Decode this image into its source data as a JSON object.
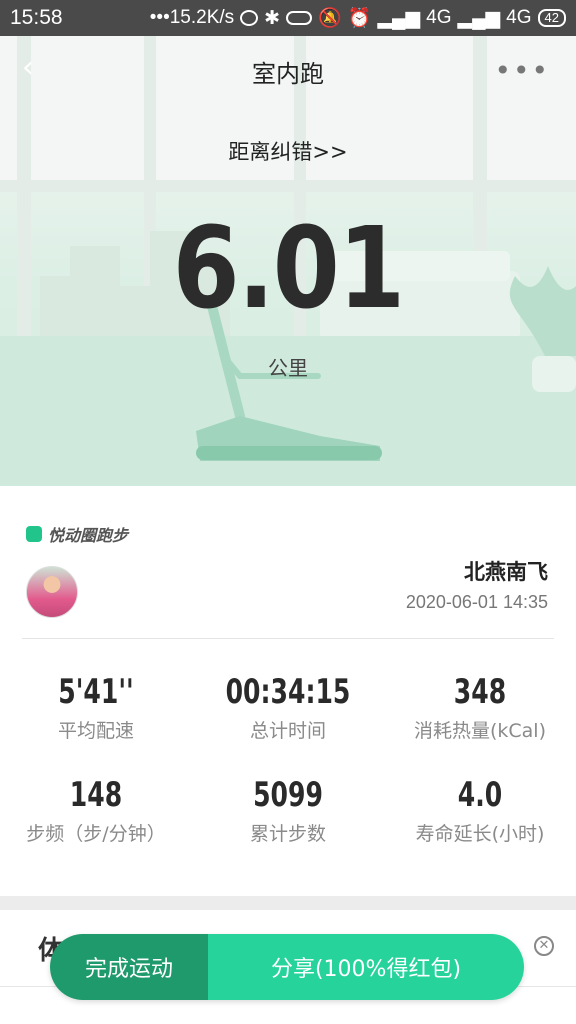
{
  "status_bar": {
    "time": "15:58",
    "network_speed": "15.2K/s",
    "signal_1": "4G",
    "signal_2": "4G",
    "battery": "42"
  },
  "header": {
    "title": "室内跑",
    "back_icon": "chevron-left-icon",
    "more_icon": "more-dots-icon"
  },
  "hero": {
    "distance_correction_link": "距离纠错>>",
    "distance_value": "6.01",
    "distance_unit": "公里"
  },
  "card": {
    "brand": "悦动圈跑步",
    "user_name": "北燕南飞",
    "datetime": "2020-06-01 14:35",
    "stats": [
      {
        "value": "5'41''",
        "label": "平均配速"
      },
      {
        "value": "00:34:15",
        "label": "总计时间"
      },
      {
        "value": "348",
        "label": "消耗热量(kCal)"
      },
      {
        "value": "148",
        "label": "步频（步/分钟）"
      },
      {
        "value": "5099",
        "label": "累计步数"
      },
      {
        "value": "4.0",
        "label": "寿命延长(小时)"
      }
    ]
  },
  "below": {
    "heading_partial": "体"
  },
  "actions": {
    "finish": "完成运动",
    "share": "分享(100%得红包)"
  },
  "colors": {
    "accent_dark": "#1f9a6c",
    "accent_light": "#26d39a",
    "hero_tint": "#d2ece0"
  }
}
